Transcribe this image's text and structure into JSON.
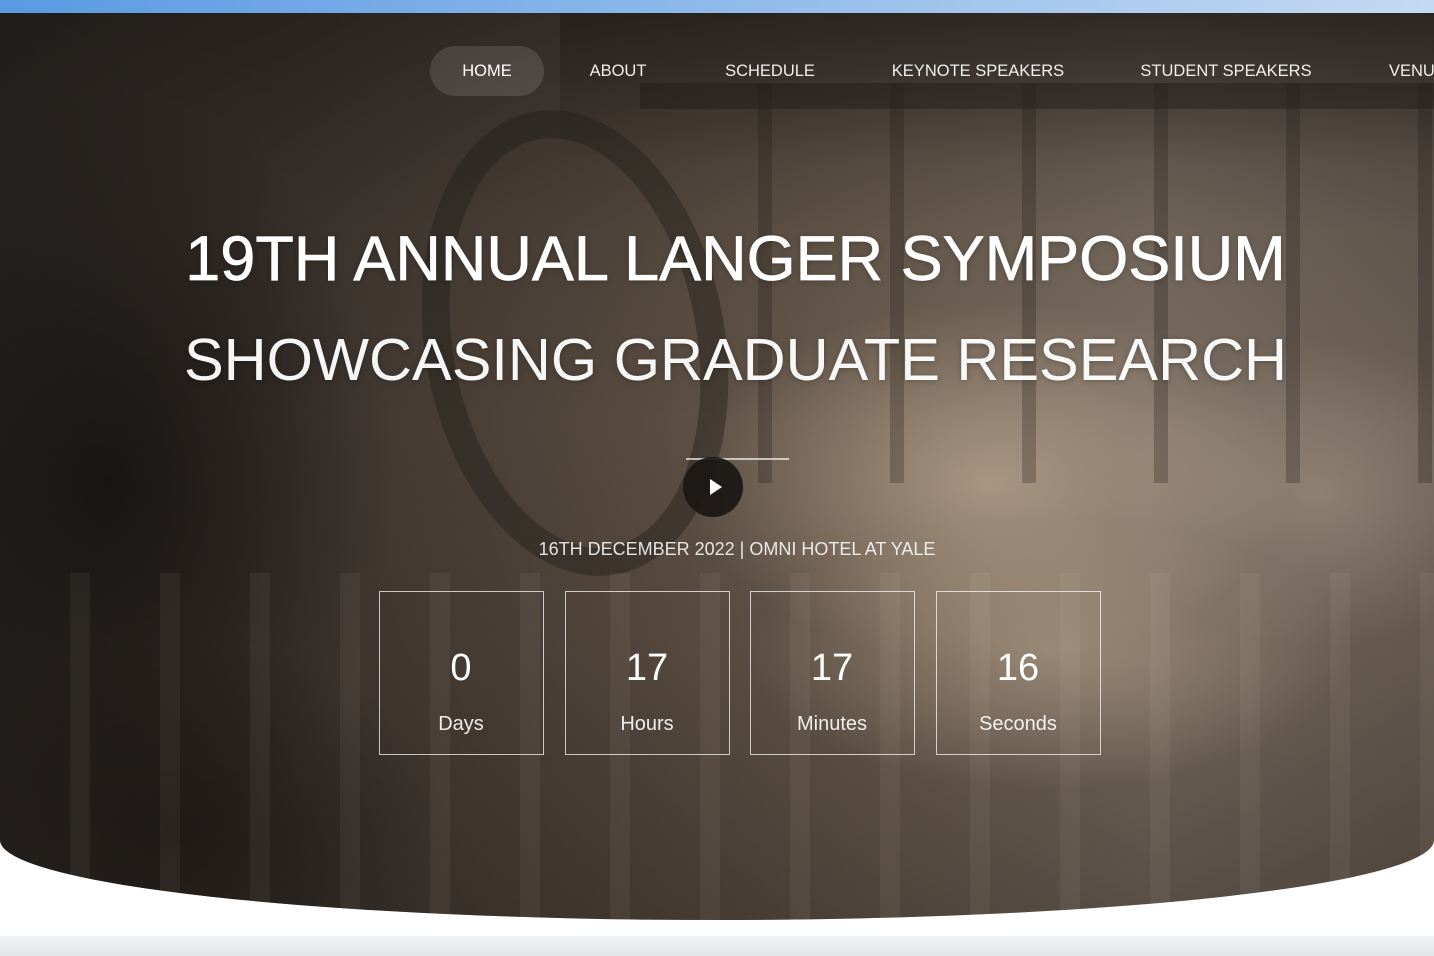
{
  "colors": {
    "top_bar_start": "#5a9ae2",
    "top_bar_end": "#c4daf2",
    "hero_text": "#ffffff",
    "play_button": "#1a1715",
    "next_section": "#e3e5e8"
  },
  "nav": {
    "items": [
      {
        "label": "HOME",
        "active": true
      },
      {
        "label": "ABOUT",
        "active": false
      },
      {
        "label": "SCHEDULE",
        "active": false
      },
      {
        "label": "KEYNOTE SPEAKERS",
        "active": false
      },
      {
        "label": "STUDENT SPEAKERS",
        "active": false
      },
      {
        "label": "VENU",
        "active": false
      }
    ]
  },
  "hero": {
    "title": "19TH ANNUAL LANGER SYMPOSIUM",
    "subtitle": "SHOWCASING GRADUATE RESEARCH",
    "event_details": "16TH DECEMBER 2022 | OMNI HOTEL AT YALE",
    "play_icon": "play-icon"
  },
  "countdown": {
    "items": [
      {
        "value": "0",
        "unit": "Days"
      },
      {
        "value": "17",
        "unit": "Hours"
      },
      {
        "value": "17",
        "unit": "Minutes"
      },
      {
        "value": "16",
        "unit": "Seconds"
      }
    ]
  }
}
